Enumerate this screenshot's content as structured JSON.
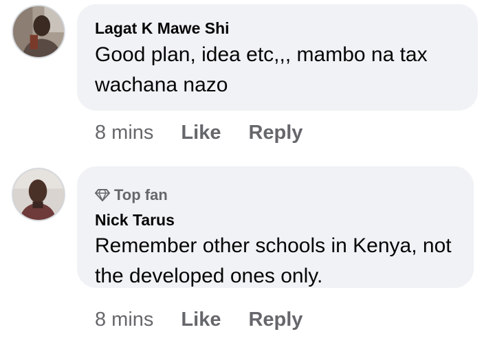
{
  "comments": [
    {
      "author": "Lagat K Mawe Shi",
      "text": "Good plan, idea etc,,, mambo na tax wachana nazo",
      "time": "8 mins",
      "like_label": "Like",
      "reply_label": "Reply"
    },
    {
      "badge": {
        "icon": "diamond-icon",
        "label": "Top fan"
      },
      "author": "Nick Tarus",
      "text": "Remember other schools in Kenya, not the developed ones only.",
      "time": "8 mins",
      "like_label": "Like",
      "reply_label": "Reply"
    }
  ],
  "colors": {
    "bubble_bg": "#f0f2f5",
    "primary_text": "#050505",
    "secondary_text": "#65676b"
  }
}
